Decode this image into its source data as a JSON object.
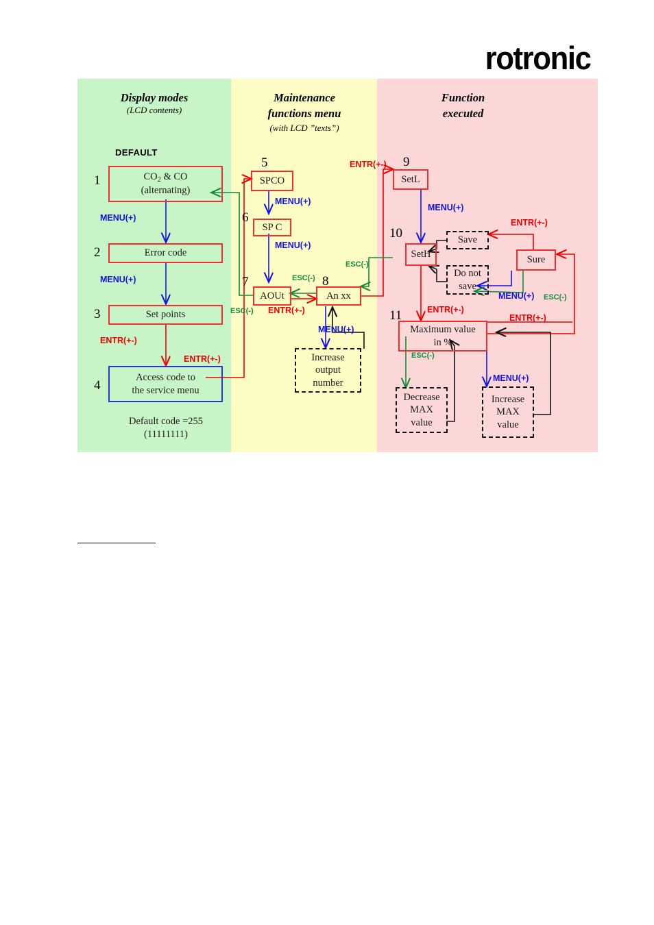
{
  "brand": {
    "logo_text": "rotronic"
  },
  "diagram": {
    "columns": [
      {
        "id": "display",
        "title": "Display modes",
        "subtitle": "(LCD contents)",
        "color": "#c8f5c8"
      },
      {
        "id": "maint",
        "title": "Maintenance\nfunctions menu",
        "subtitle": "(with LCD ”texts”)",
        "color": "#fcfcc4"
      },
      {
        "id": "function",
        "title": "Function\nexecuted",
        "subtitle": "",
        "color": "#fcd7d7"
      }
    ],
    "default_tag": "DEFAULT",
    "nodes": [
      {
        "num": "1",
        "text": "CO₂ & CO\n(alternating)",
        "style": "solid-red"
      },
      {
        "num": "2",
        "text": "Error code",
        "style": "solid-red"
      },
      {
        "num": "3",
        "text": "Set points",
        "style": "solid-red"
      },
      {
        "num": "4",
        "text": "Access code to\nthe service menu",
        "style": "solid-blue"
      },
      {
        "num": "5",
        "text": "SPCO",
        "style": "solid-red"
      },
      {
        "num": "6",
        "text": "SP C",
        "style": "solid-red"
      },
      {
        "num": "7",
        "text": "AOUt",
        "style": "solid-red"
      },
      {
        "num": "8",
        "text": "An xx",
        "style": "solid-red"
      },
      {
        "num": "9",
        "text": "SetL",
        "style": "solid-red"
      },
      {
        "num": "10",
        "text": "SetH",
        "style": "solid-red"
      },
      {
        "num": "11",
        "text": "Maximum value\nin %",
        "style": "solid-red"
      },
      {
        "num": "",
        "text": "Increase\noutput\nnumber",
        "style": "dashed"
      },
      {
        "num": "",
        "text": "Save",
        "style": "dashed"
      },
      {
        "num": "",
        "text": "Do not\nsave",
        "style": "dashed"
      },
      {
        "num": "",
        "text": "Sure",
        "style": "solid-red"
      },
      {
        "num": "",
        "text": "Decrease\nMAX\nvalue",
        "style": "dashed"
      },
      {
        "num": "",
        "text": "Increase\nMAX\nvalue",
        "style": "dashed"
      }
    ],
    "notes": {
      "default_code": "Default code =255\n(11111111)"
    },
    "edge_labels": {
      "menu": "MENU(+)",
      "entr": "ENTR(+-)",
      "esc": "ESC(-)"
    },
    "colors": {
      "menu": "#1414e0",
      "entr": "#ee0000",
      "esc": "#118c3a",
      "black": "#111111",
      "box_red": "#f03030",
      "box_blue": "#2a36c8"
    }
  }
}
